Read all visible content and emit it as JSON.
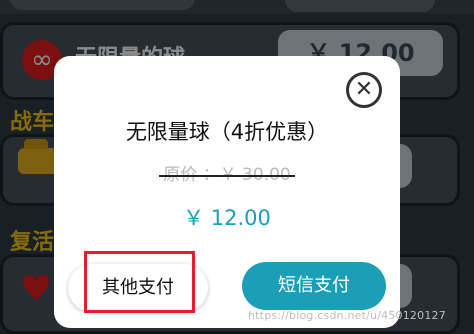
{
  "background": {
    "item_name": "无限量的球",
    "item_price": "￥ 12.00",
    "section_car": "战车",
    "section_revive": "复活"
  },
  "dialog": {
    "title": "无限量球（4折优惠）",
    "original_price": "原价 ：￥ 30.00",
    "price": "￥ 12.00",
    "other_pay_label": "其他支付",
    "sms_pay_label": "短信支付",
    "close_icon": "close-icon"
  },
  "watermark": "https://blog.csdn.net/u/450120127",
  "colors": {
    "accent": "#1b9fb7",
    "highlight": "#e0202a"
  }
}
